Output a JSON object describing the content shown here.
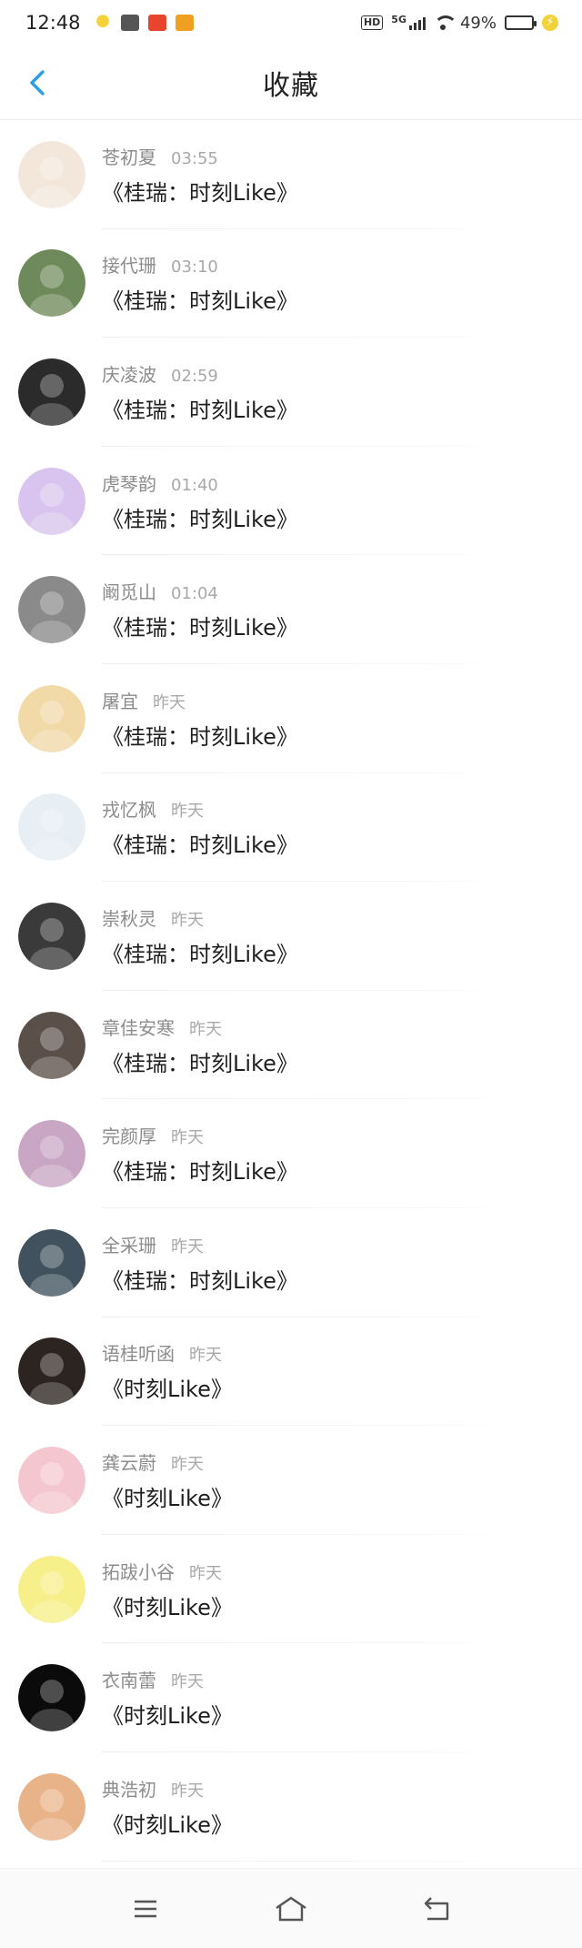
{
  "status_bar": {
    "time": "12:48",
    "network": "5G",
    "hd": "HD",
    "battery_percent": "49%",
    "battery_level": 0.49,
    "left_icons": [
      "bulb-icon",
      "card-icon",
      "s5-app-icon",
      "weibo-icon"
    ]
  },
  "header": {
    "title": "收藏",
    "back_icon": "chevron-left-icon",
    "accent_color": "#2a9de6"
  },
  "items": [
    {
      "name": "苍初夏",
      "time": "03:55",
      "title": "《桂瑞：时刻Like》",
      "avatar_color": "#f3e7dc"
    },
    {
      "name": "接代珊",
      "time": "03:10",
      "title": "《桂瑞：时刻Like》",
      "avatar_color": "#6f8a5a"
    },
    {
      "name": "庆凌波",
      "time": "02:59",
      "title": "《桂瑞：时刻Like》",
      "avatar_color": "#2b2b2b"
    },
    {
      "name": "虎琴韵",
      "time": "01:40",
      "title": "《桂瑞：时刻Like》",
      "avatar_color": "#d8c4ee"
    },
    {
      "name": "阚觅山",
      "time": "01:04",
      "title": "《桂瑞：时刻Like》",
      "avatar_color": "#8a8a8a"
    },
    {
      "name": "屠宜",
      "time": "昨天",
      "title": "《桂瑞：时刻Like》",
      "avatar_color": "#f1d9a8"
    },
    {
      "name": "戎忆枫",
      "time": "昨天",
      "title": "《桂瑞：时刻Like》",
      "avatar_color": "#e7eef4"
    },
    {
      "name": "崇秋灵",
      "time": "昨天",
      "title": "《桂瑞：时刻Like》",
      "avatar_color": "#3a3a3a"
    },
    {
      "name": "章佳安寒",
      "time": "昨天",
      "title": "《桂瑞：时刻Like》",
      "avatar_color": "#5b4f4a"
    },
    {
      "name": "完颜厚",
      "time": "昨天",
      "title": "《桂瑞：时刻Like》",
      "avatar_color": "#c9a6c4"
    },
    {
      "name": "全采珊",
      "time": "昨天",
      "title": "《桂瑞：时刻Like》",
      "avatar_color": "#41525e"
    },
    {
      "name": "语桂听函",
      "time": "昨天",
      "title": "《时刻Like》",
      "avatar_color": "#2c2420"
    },
    {
      "name": "龚云蔚",
      "time": "昨天",
      "title": "《时刻Like》",
      "avatar_color": "#f4c6cf"
    },
    {
      "name": "拓跋小谷",
      "time": "昨天",
      "title": "《时刻Like》",
      "avatar_color": "#f7ef8a"
    },
    {
      "name": "衣南蕾",
      "time": "昨天",
      "title": "《时刻Like》",
      "avatar_color": "#0b0b0b"
    },
    {
      "name": "典浩初",
      "time": "昨天",
      "title": "《时刻Like》",
      "avatar_color": "#e9b38a"
    }
  ],
  "nav": {
    "menu_icon": "menu-icon",
    "home_icon": "home-icon",
    "back_icon": "return-icon"
  }
}
